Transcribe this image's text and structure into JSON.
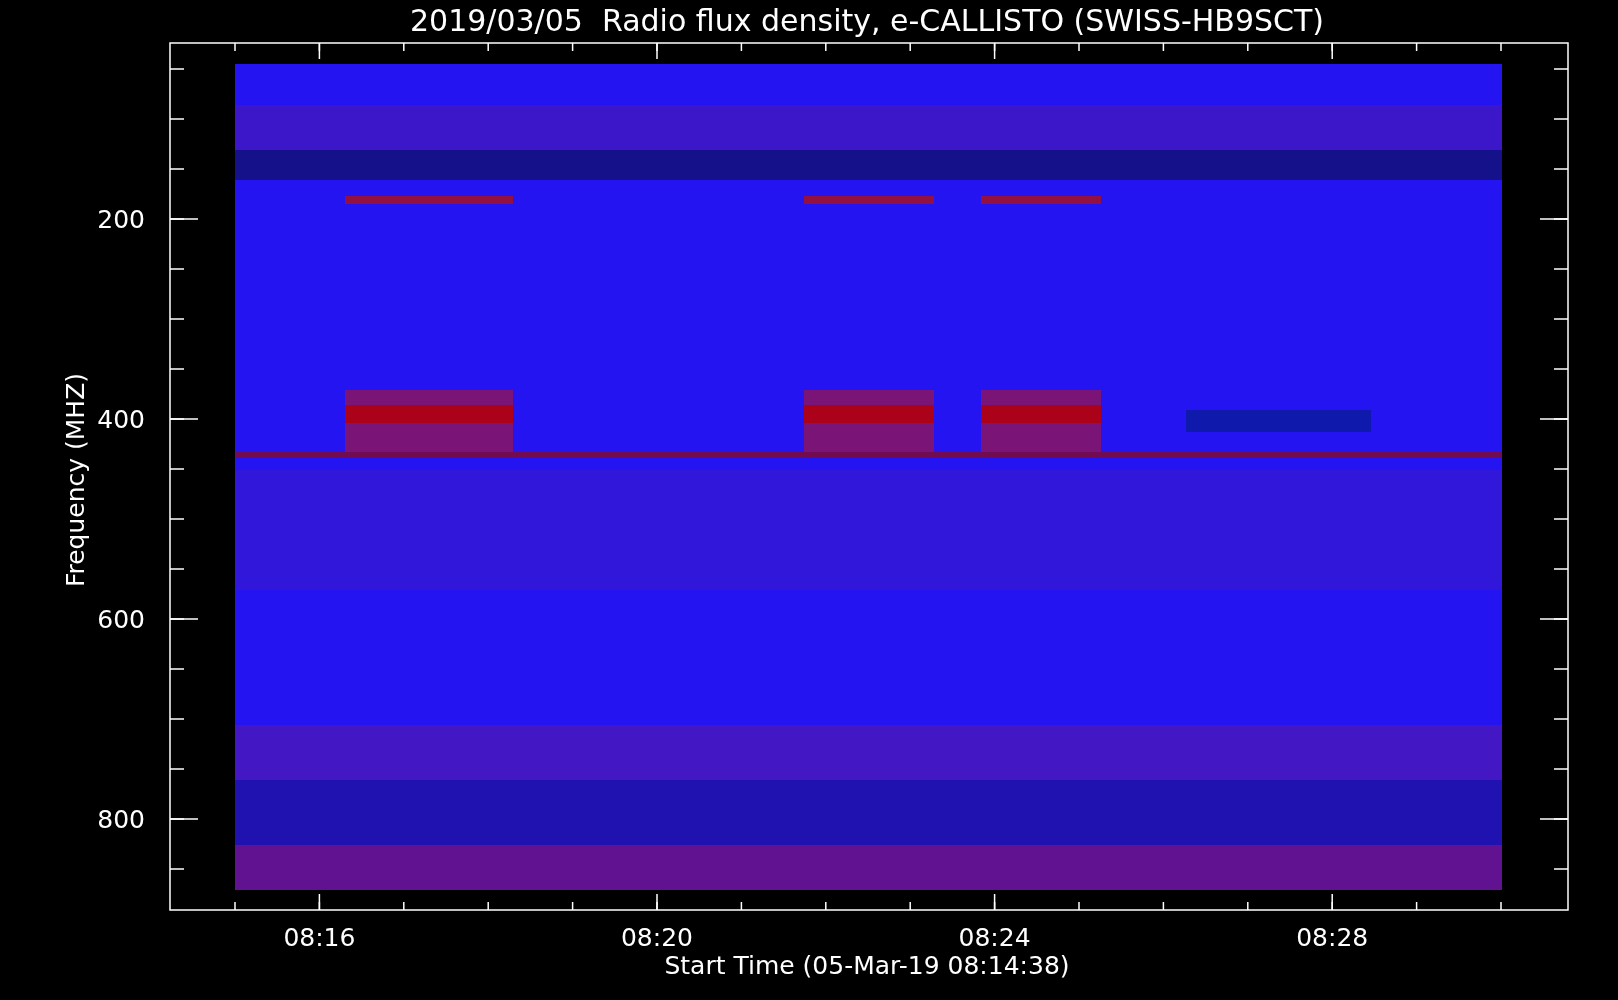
{
  "title": "2019/03/05  Radio flux density, e-CALLISTO (SWISS-HB9SCT)",
  "y_axis": {
    "label": "Frequency (MHZ)",
    "ticks": [
      "200",
      "400",
      "600",
      "800"
    ]
  },
  "x_axis": {
    "label": "Start Time (05-Mar-19 08:14:38)",
    "ticks": [
      "08:16",
      "08:20",
      "08:24",
      "08:28"
    ]
  }
}
